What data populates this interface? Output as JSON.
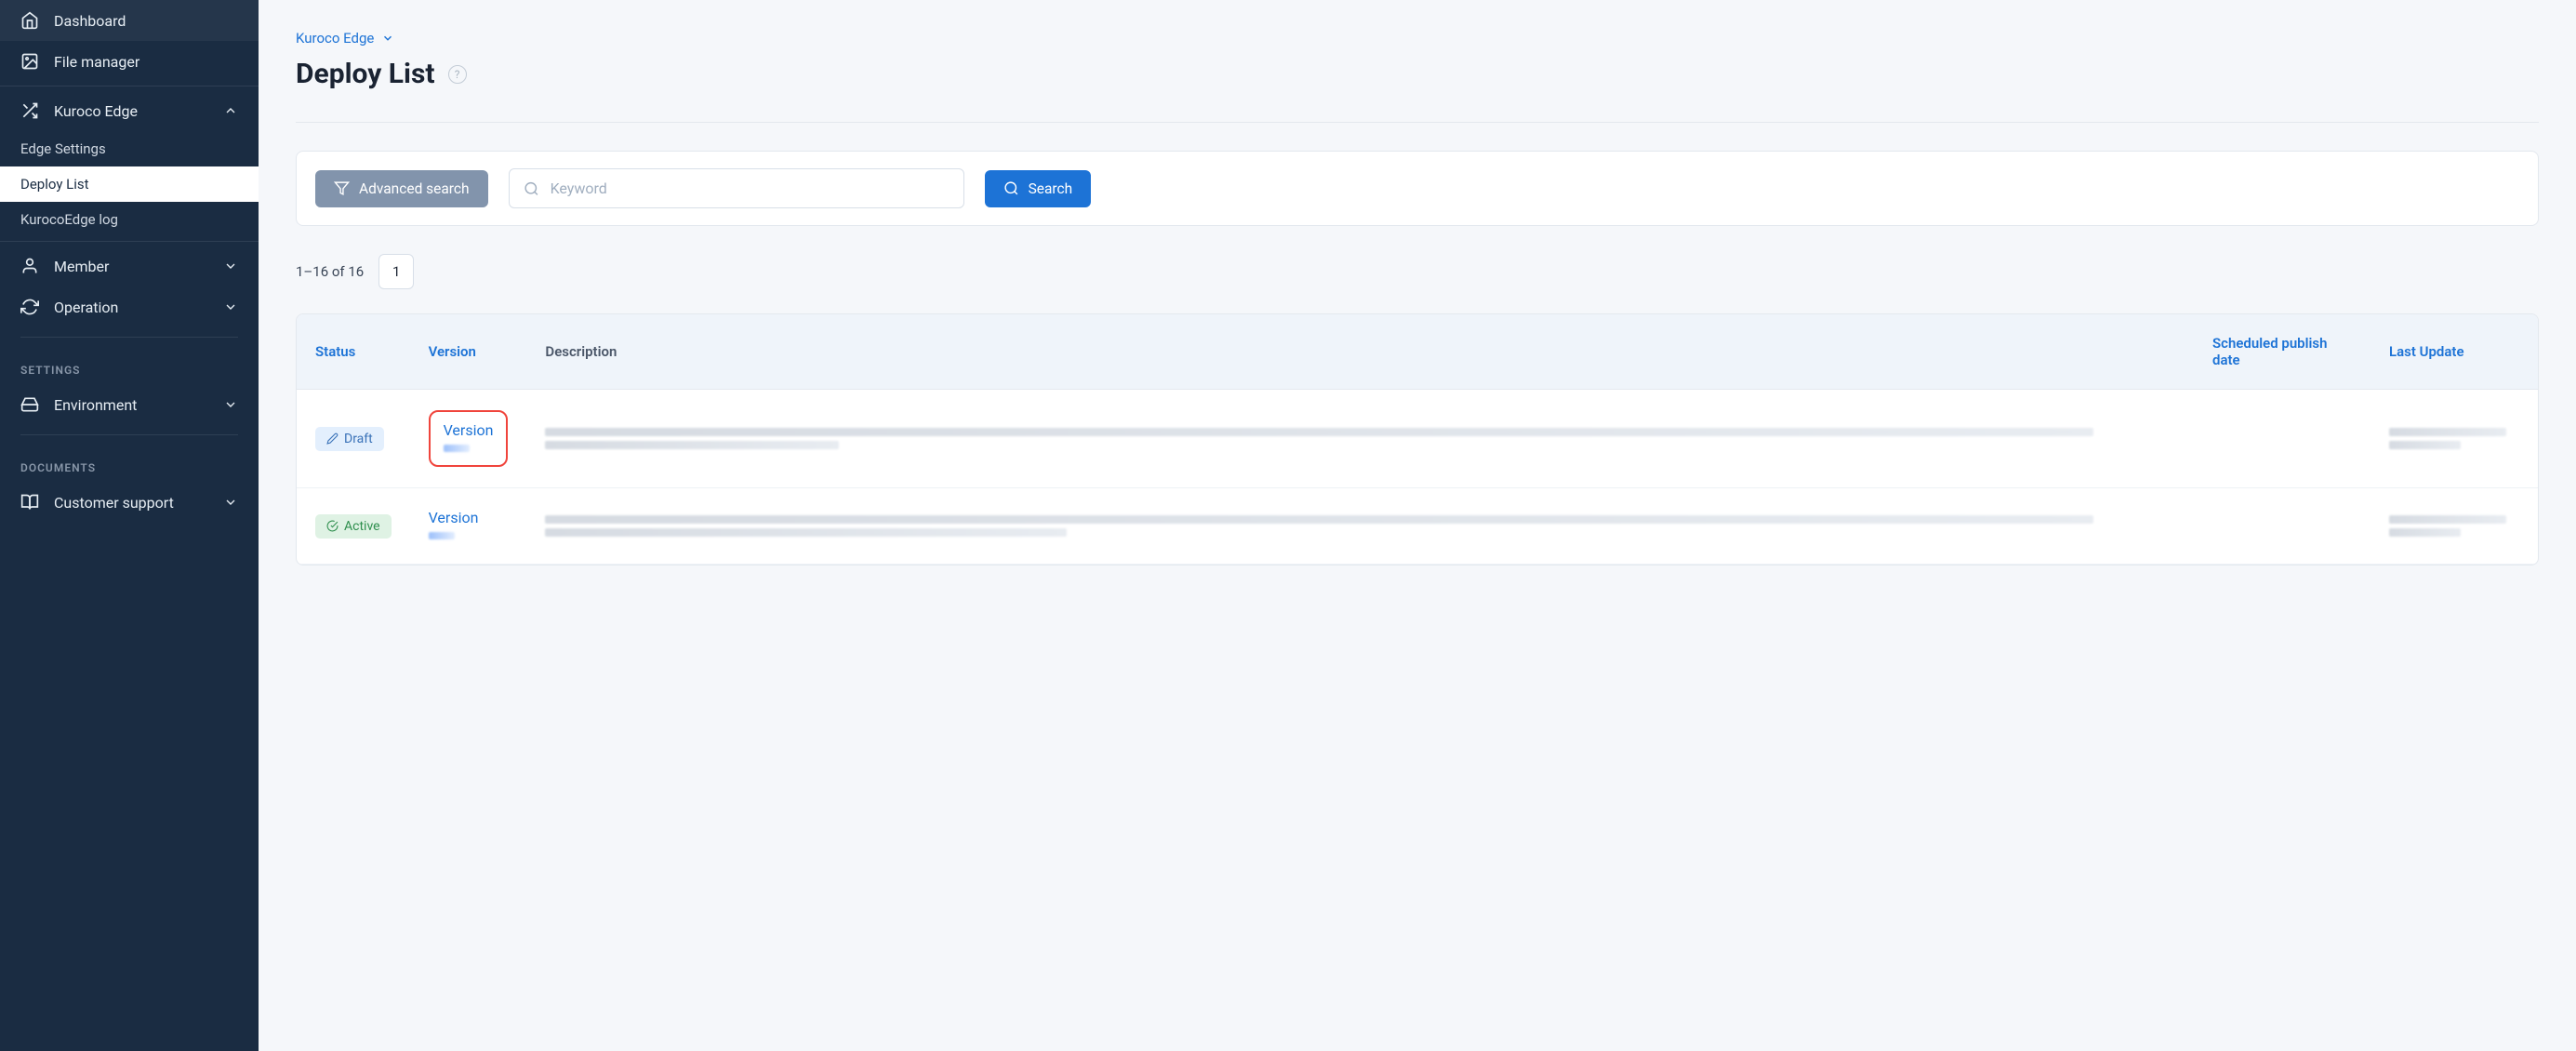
{
  "sidebar": {
    "dashboard": "Dashboard",
    "file_manager": "File manager",
    "kuroco_edge": "Kuroco Edge",
    "edge_settings": "Edge Settings",
    "deploy_list": "Deploy List",
    "kuroco_log": "KurocoEdge log",
    "member": "Member",
    "operation": "Operation",
    "heading_settings": "SETTINGS",
    "environment": "Environment",
    "heading_documents": "DOCUMENTS",
    "customer_support": "Customer support"
  },
  "header": {
    "breadcrumb": "Kuroco Edge",
    "title": "Deploy List"
  },
  "search": {
    "advanced": "Advanced search",
    "placeholder": "Keyword",
    "search_btn": "Search"
  },
  "pagination": {
    "range": "1–16 of 16",
    "page": "1"
  },
  "table": {
    "cols": {
      "status": "Status",
      "version": "Version",
      "description": "Description",
      "scheduled": "Scheduled publish date",
      "last_update": "Last Update"
    },
    "rows": [
      {
        "status": "Draft",
        "status_kind": "draft",
        "version": "Version",
        "highlight": true
      },
      {
        "status": "Active",
        "status_kind": "active",
        "version": "Version",
        "highlight": false
      }
    ]
  }
}
